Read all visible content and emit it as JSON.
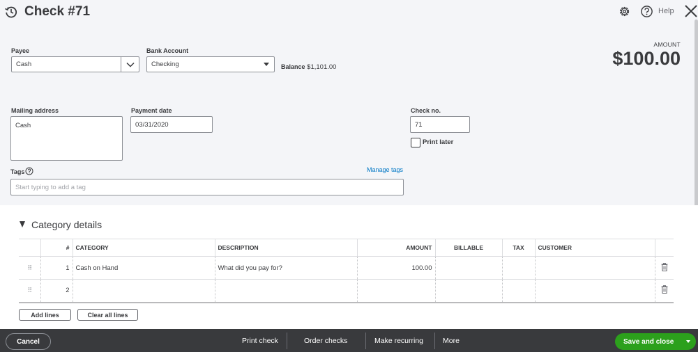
{
  "header": {
    "title": "Check #71",
    "help_label": "Help",
    "icons": [
      "history-icon",
      "gear-icon",
      "help-icon",
      "close-icon"
    ]
  },
  "form": {
    "payee": {
      "label": "Payee",
      "value": "Cash"
    },
    "bank_account": {
      "label": "Bank Account",
      "value": "Checking"
    },
    "balance": {
      "label": "Balance",
      "value": "$1,101.00"
    },
    "amount": {
      "label": "AMOUNT",
      "value": "$100.00"
    },
    "mailing_address": {
      "label": "Mailing address",
      "value": "Cash"
    },
    "payment_date": {
      "label": "Payment date",
      "value": "03/31/2020"
    },
    "check_no": {
      "label": "Check no.",
      "value": "71"
    },
    "print_later": {
      "label": "Print later",
      "checked": false
    },
    "tags": {
      "label": "Tags",
      "placeholder": "Start typing to add a tag",
      "manage_label": "Manage tags"
    }
  },
  "category_details": {
    "title": "Category details",
    "columns": {
      "num": "#",
      "category": "CATEGORY",
      "description": "DESCRIPTION",
      "amount": "AMOUNT",
      "billable": "BILLABLE",
      "tax": "TAX",
      "customer": "CUSTOMER"
    },
    "rows": [
      {
        "num": "1",
        "category": "Cash on Hand",
        "description": "",
        "description_placeholder": "What did you pay for?",
        "amount": "100.00"
      },
      {
        "num": "2",
        "category": "",
        "description": "",
        "amount": ""
      }
    ],
    "add_lines_label": "Add lines",
    "clear_lines_label": "Clear all lines"
  },
  "footer": {
    "cancel_label": "Cancel",
    "print_check_label": "Print check",
    "order_checks_label": "Order checks",
    "make_recurring_label": "Make recurring",
    "more_label": "More",
    "save_label": "Save and close"
  },
  "colors": {
    "accent_green": "#2ca01c",
    "link_blue": "#0077c5",
    "footer_bg": "#393a3d",
    "page_bg": "#f4f5f8"
  }
}
